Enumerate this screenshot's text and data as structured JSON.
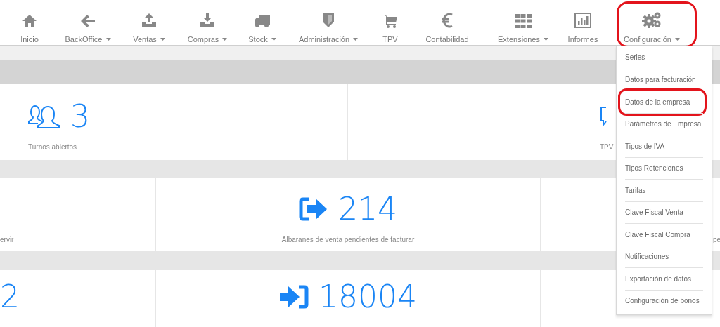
{
  "nav": [
    {
      "label": "Inicio",
      "dropdown": false,
      "highlighted": false
    },
    {
      "label": "BackOffice",
      "dropdown": true,
      "highlighted": false
    },
    {
      "label": "Ventas",
      "dropdown": true,
      "highlighted": false
    },
    {
      "label": "Compras",
      "dropdown": true,
      "highlighted": false
    },
    {
      "label": "Stock",
      "dropdown": true,
      "highlighted": false
    },
    {
      "label": "Administración",
      "dropdown": true,
      "highlighted": false
    },
    {
      "label": "TPV",
      "dropdown": false,
      "highlighted": false
    },
    {
      "label": "Contabilidad",
      "dropdown": false,
      "highlighted": false
    },
    {
      "label": "Extensiones",
      "dropdown": true,
      "highlighted": false
    },
    {
      "label": "Informes",
      "dropdown": false,
      "highlighted": false
    },
    {
      "label": "Configuración",
      "dropdown": true,
      "highlighted": true
    }
  ],
  "rows": [
    [
      {
        "value": "3",
        "label": "Turnos abiertos"
      },
      {
        "label": "TPV"
      }
    ],
    [
      {
        "label": "ervir"
      },
      {
        "value": "214",
        "label": "Albaranes de venta pendientes de facturar"
      },
      {
        "label": "pe"
      }
    ],
    [
      {
        "value": "2"
      },
      {
        "value": "18004"
      }
    ]
  ],
  "menu": [
    {
      "label": "Series",
      "highlighted": false
    },
    {
      "label": "Datos para facturación",
      "highlighted": false
    },
    {
      "label": "Datos de la empresa",
      "highlighted": true
    },
    {
      "label": "Parámetros de Empresa",
      "highlighted": false
    },
    {
      "label": "Tipos de IVA",
      "highlighted": false
    },
    {
      "label": "Tipos Retenciones",
      "highlighted": false
    },
    {
      "label": "Tarifas",
      "highlighted": false
    },
    {
      "label": "Clave Fiscal Venta",
      "highlighted": false
    },
    {
      "label": "Clave Fiscal Compra",
      "highlighted": false
    },
    {
      "label": "Notificaciones",
      "highlighted": false
    },
    {
      "label": "Exportación de datos",
      "highlighted": false
    },
    {
      "label": "Configuración de bonos",
      "highlighted": false
    }
  ]
}
